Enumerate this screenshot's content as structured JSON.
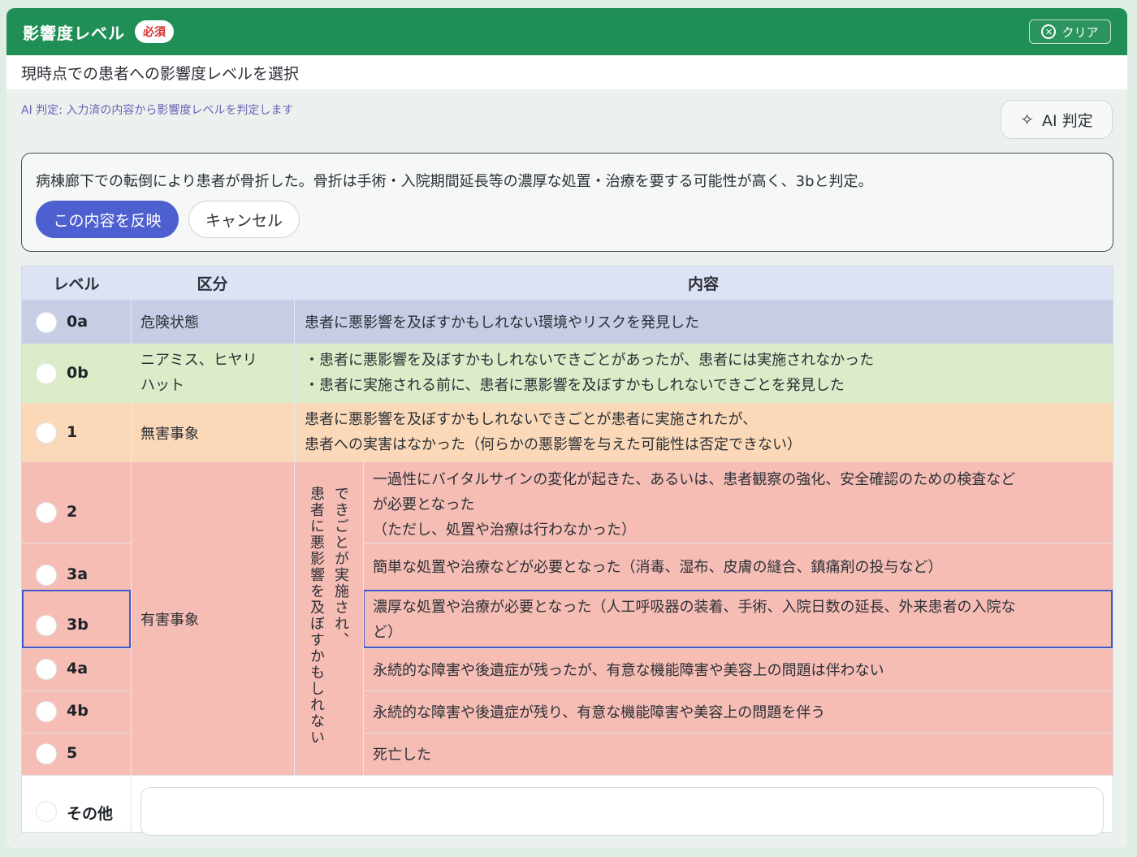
{
  "header": {
    "title": "影響度レベル",
    "required_badge": "必須",
    "clear_label": "クリア"
  },
  "subtitle": "現時点での患者への影響度レベルを選択",
  "ai": {
    "hint": "AI 判定: 入力済の内容から影響度レベルを判定します",
    "button_label": "AI 判定",
    "result_text": "病棟廊下での転倒により患者が骨折した。骨折は手術・入院期間延長等の濃厚な処置・治療を要する可能性が高く、3bと判定。",
    "apply_label": "この内容を反映",
    "cancel_label": "キャンセル"
  },
  "table": {
    "columns": [
      "レベル",
      "区分",
      "内容"
    ],
    "rows": [
      {
        "level": "0a",
        "category": "危険状態",
        "content": [
          "患者に悪影響を及ぼすかもしれない環境やリスクを発見した"
        ],
        "selected": false
      },
      {
        "level": "0b",
        "category": [
          "ニアミス、ヒヤリ",
          "ハット"
        ],
        "content": [
          "・患者に悪影響を及ぼすかもしれないできごとがあったが、患者には実施されなかった",
          "・患者に実施される前に、患者に悪影響を及ぼすかもしれないできごとを発見した"
        ],
        "selected": false
      },
      {
        "level": "1",
        "category": "無害事象",
        "content": [
          "患者に悪影響を及ぼすかもしれないできごとが患者に実施されたが、",
          "患者への実害はなかった（何らかの悪影響を与えた可能性は否定できない）"
        ],
        "selected": false
      },
      {
        "level": "2",
        "content": [
          "一過性にバイタルサインの変化が起きた、あるいは、患者観察の強化、安全確認のための検査など",
          "が必要となった",
          "（ただし、処置や治療は行わなかった）"
        ],
        "selected": false
      },
      {
        "level": "3a",
        "content": [
          "簡単な処置や治療などが必要となった（消毒、湿布、皮膚の縫合、鎮痛剤の投与など）"
        ],
        "selected": false
      },
      {
        "level": "3b",
        "content": [
          "濃厚な処置や治療が必要となった（人工呼吸器の装着、手術、入院日数の延長、外来患者の入院な",
          "ど）"
        ],
        "selected": false,
        "highlighted": true
      },
      {
        "level": "4a",
        "content": [
          "永続的な障害や後遺症が残ったが、有意な機能障害や美容上の問題は伴わない"
        ],
        "selected": false
      },
      {
        "level": "4b",
        "content": [
          "永続的な障害や後遺症が残り、有意な機能障害や美容上の問題を伴う"
        ],
        "selected": false
      },
      {
        "level": "5",
        "content": [
          "死亡した"
        ],
        "selected": false
      }
    ],
    "harmful_category": "有害事象",
    "harmful_note": [
      "できごとが実施され、",
      "患者に悪影響を及ぼすかもしれない"
    ],
    "other_label": "その他",
    "other_value": ""
  },
  "colors": {
    "header_green": "#1f8f55",
    "row_0a": "#c7cde4",
    "row_0b": "#dcebc8",
    "row_1": "#fbd9b8",
    "row_harm": "#f6bdb5",
    "accent_blue": "#4e5fcf",
    "required_red": "#d6322e"
  }
}
